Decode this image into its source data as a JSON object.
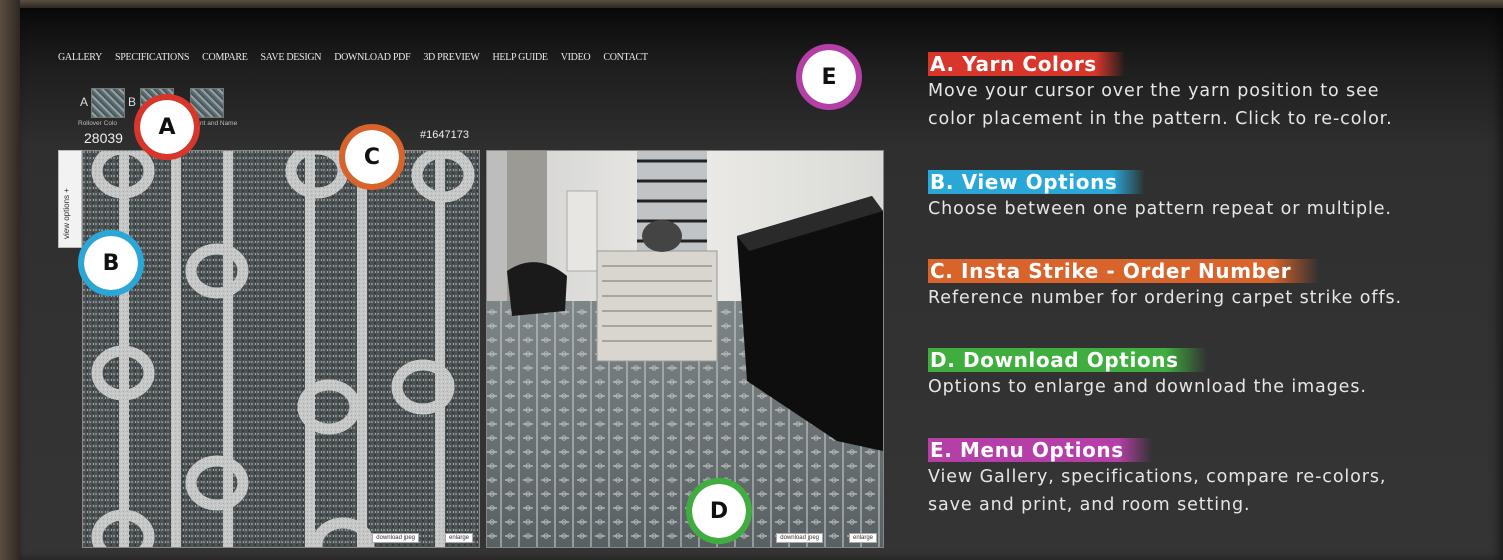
{
  "nav": {
    "items": [
      "GALLERY",
      "SPECIFICATIONS",
      "COMPARE",
      "SAVE DESIGN",
      "DOWNLOAD PDF",
      "3D PREVIEW",
      "HELP GUIDE",
      "VIDEO",
      "CONTACT"
    ]
  },
  "yarn": {
    "label_a": "A",
    "label_b": "B",
    "rollover_text": "Rollover Colo",
    "print_text": "nt and Name",
    "pattern_number": "28039",
    "order_number": "#1647173"
  },
  "view_tab": {
    "label": "view options +"
  },
  "download": {
    "pattern_jpg": "download jpeg",
    "pattern_enlarge": "enlarge",
    "room_jpg": "download jpeg",
    "room_enlarge": "enlarge"
  },
  "badges": {
    "a": "A",
    "b": "B",
    "c": "C",
    "d": "D",
    "e": "E"
  },
  "legend": [
    {
      "title": "A. Yarn Colors",
      "color": "#d8362b",
      "lines": [
        "Move your cursor over the yarn position to see",
        "color placement in the pattern. Click to re-color."
      ]
    },
    {
      "title": "B. View Options",
      "color": "#29a8d8",
      "lines": [
        "Choose between one pattern repeat or multiple."
      ]
    },
    {
      "title": "C. Insta Strike - Order Number",
      "color": "#d8632b",
      "lines": [
        "Reference number for ordering carpet strike offs."
      ]
    },
    {
      "title": "D. Download Options",
      "color": "#3fae3f",
      "lines": [
        "Options to enlarge and download the images."
      ]
    },
    {
      "title": "E. Menu Options",
      "color": "#b53fa6",
      "lines": [
        "View Gallery, specifications, compare re-colors,",
        "save and print, and room setting."
      ]
    }
  ]
}
